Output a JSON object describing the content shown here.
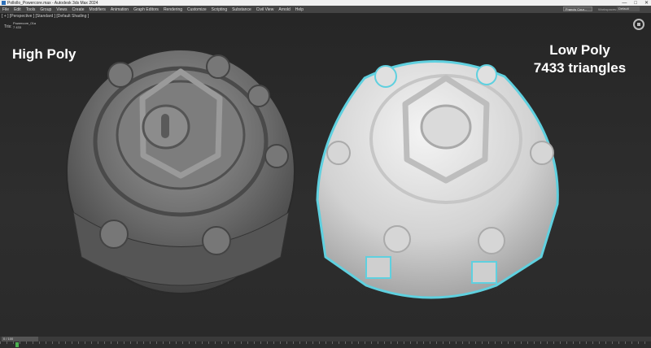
{
  "window": {
    "title": "Pollollo_Powercore.max - Autodesk 3ds Max 2024",
    "controls": [
      "—",
      "□",
      "✕"
    ]
  },
  "menubar": {
    "items": [
      "File",
      "Edit",
      "Tools",
      "Group",
      "Views",
      "Create",
      "Modifiers",
      "Animation",
      "Graph Editors",
      "Rendering",
      "Customize",
      "Scripting",
      "Substance",
      "Civil View",
      "Arnold",
      "Help"
    ],
    "signin": "Francis Cour...",
    "workspace_label": "Workspaces:",
    "workspace_value": "Default"
  },
  "viewport": {
    "label": "[ + ] [Perspective ] [Standard ] [Default Shading ]",
    "stats": {
      "key": "Tris:",
      "object": "Powercore_01a",
      "value": "7 433"
    },
    "captions": {
      "left": "High Poly",
      "right_line1": "Low Poly",
      "right_line2": "7433 triangles"
    }
  },
  "timeline": {
    "frame": "0 / 100"
  },
  "colors": {
    "selection_outline": "#5fd0df",
    "viewport_bg": "#2b2b2b"
  }
}
